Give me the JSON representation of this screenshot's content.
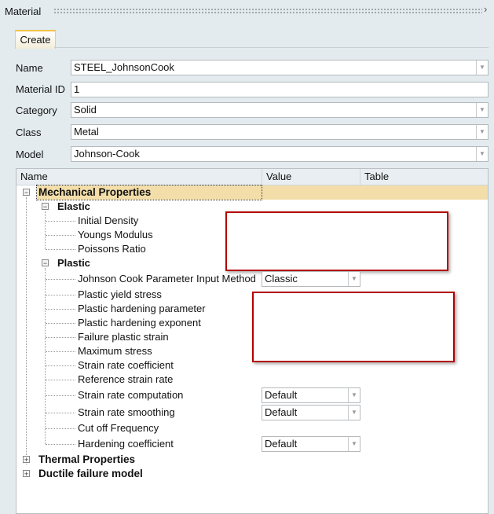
{
  "panel": {
    "title": "Material",
    "close_icon": "chevron-right-icon"
  },
  "tabs": [
    {
      "label": "Create",
      "active": true
    }
  ],
  "form": {
    "name": {
      "label": "Name",
      "value": "STEEL_JohnsonCook"
    },
    "material_id": {
      "label": "Material ID",
      "value": "1"
    },
    "category": {
      "label": "Category",
      "value": "Solid"
    },
    "class": {
      "label": "Class",
      "value": "Metal"
    },
    "model": {
      "label": "Model",
      "value": "Johnson-Cook"
    }
  },
  "tree": {
    "columns": [
      "Name",
      "Value",
      "Table"
    ],
    "rows": [
      {
        "label": "Mechanical Properties",
        "level": 0,
        "bold": true,
        "expander": "minus",
        "selected": true
      },
      {
        "label": "Elastic",
        "level": 1,
        "bold": true,
        "expander": "minus"
      },
      {
        "label": "Initial Density",
        "level": 2
      },
      {
        "label": "Youngs Modulus",
        "level": 2
      },
      {
        "label": "Poissons Ratio",
        "level": 2
      },
      {
        "label": "Plastic",
        "level": 1,
        "bold": true,
        "expander": "minus"
      },
      {
        "label": "Johnson Cook Parameter Input Method",
        "level": 2,
        "value": "Classic"
      },
      {
        "label": "Plastic yield stress",
        "level": 2
      },
      {
        "label": "Plastic hardening parameter",
        "level": 2
      },
      {
        "label": "Plastic hardening exponent",
        "level": 2
      },
      {
        "label": "Failure plastic strain",
        "level": 2
      },
      {
        "label": "Maximum stress",
        "level": 2
      },
      {
        "label": "Strain rate coefficient",
        "level": 2
      },
      {
        "label": "Reference strain rate",
        "level": 2
      },
      {
        "label": "Strain rate computation",
        "level": 2,
        "value": "Default"
      },
      {
        "label": "Strain rate smoothing",
        "level": 2,
        "value": "Default"
      },
      {
        "label": "Cut off Frequency",
        "level": 2
      },
      {
        "label": "Hardening coefficient",
        "level": 2,
        "value": "Default"
      },
      {
        "label": "Thermal Properties",
        "level": 0,
        "bold": true,
        "expander": "plus"
      },
      {
        "label": "Ductile failure model",
        "level": 0,
        "bold": true,
        "expander": "plus"
      }
    ]
  },
  "colors": {
    "selected_row": "#f3deaa",
    "highlight_box": "#b30000",
    "tab_accent": "#f0c24a"
  }
}
